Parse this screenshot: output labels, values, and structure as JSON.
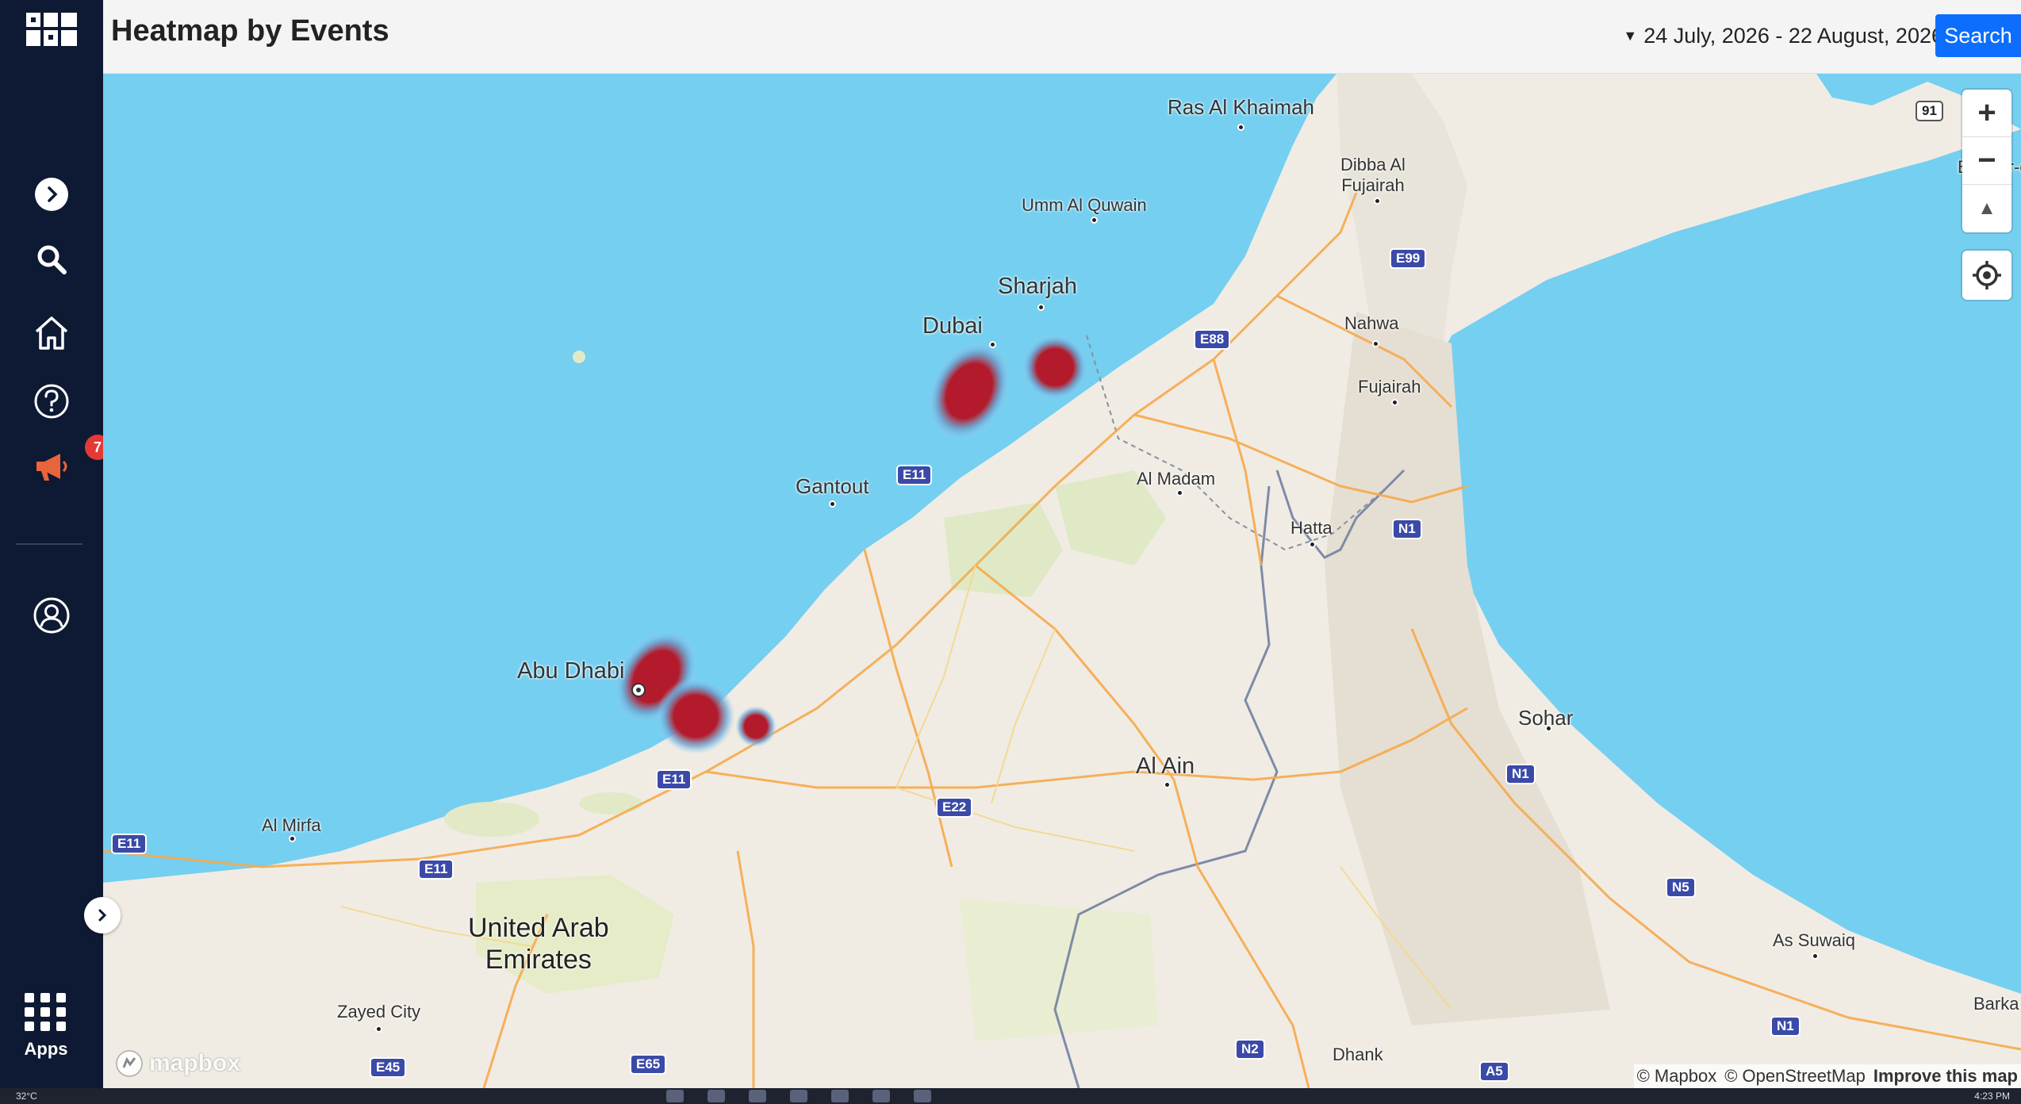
{
  "header": {
    "title": "Heatmap by Events",
    "date_range": "24 July, 2026 - 22 August, 2026",
    "search_label": "Search"
  },
  "sidebar": {
    "notification_count": "7",
    "apps_label": "Apps",
    "items": [
      {
        "icon": "logo-grid-icon"
      },
      {
        "icon": "expand-arrow-icon"
      },
      {
        "icon": "search-icon"
      },
      {
        "icon": "home-icon"
      },
      {
        "icon": "help-icon"
      },
      {
        "icon": "megaphone-icon"
      },
      {
        "icon": "user-profile-icon"
      },
      {
        "icon": "apps-grid-icon"
      }
    ],
    "accent_color": "#e8643a"
  },
  "map": {
    "labels": {
      "ras_al_khaimah": "Ras Al Khaimah",
      "dibba": "Dibba Al\nFujairah",
      "umm_al_quwain": "Umm Al Quwain",
      "sharjah": "Sharjah",
      "dubai": "Dubai",
      "nahwa": "Nahwa",
      "fujairah": "Fujairah",
      "al_madam": "Al Madam",
      "hatta": "Hatta",
      "gantout": "Gantout",
      "abu_dhabi": "Abu Dhabi",
      "al_ain": "Al Ain",
      "sohar": "Sohar",
      "al_mirfa": "Al Mirfa",
      "country": "United Arab\nEmirates",
      "zayed_city": "Zayed City",
      "dhank": "Dhank",
      "as_suwaiq": "As Suwaiq",
      "barka": "Barka",
      "bandar": "Bandar-e"
    },
    "shields": {
      "e11_a": "E11",
      "e11_b": "E11",
      "e11_c": "E11",
      "e11_d": "E11",
      "e88": "E88",
      "e99": "E99",
      "e22": "E22",
      "e45": "E45",
      "e65": "E65",
      "n1_a": "N1",
      "n1_b": "N1",
      "n1_c": "N1",
      "n2": "N2",
      "n5": "N5",
      "a5": "A5",
      "r91": "91"
    },
    "heat_color": "#b31b2c",
    "water_color": "#75cff0",
    "zoom_in": "+",
    "zoom_out": "−",
    "compass": "▲",
    "mapbox_logo": "mapbox",
    "attribution_mapbox": "© Mapbox",
    "attribution_osm": "© OpenStreetMap",
    "improve_map": "Improve this map"
  },
  "taskbar": {
    "weather": "32°C",
    "time": "4:23 PM"
  }
}
